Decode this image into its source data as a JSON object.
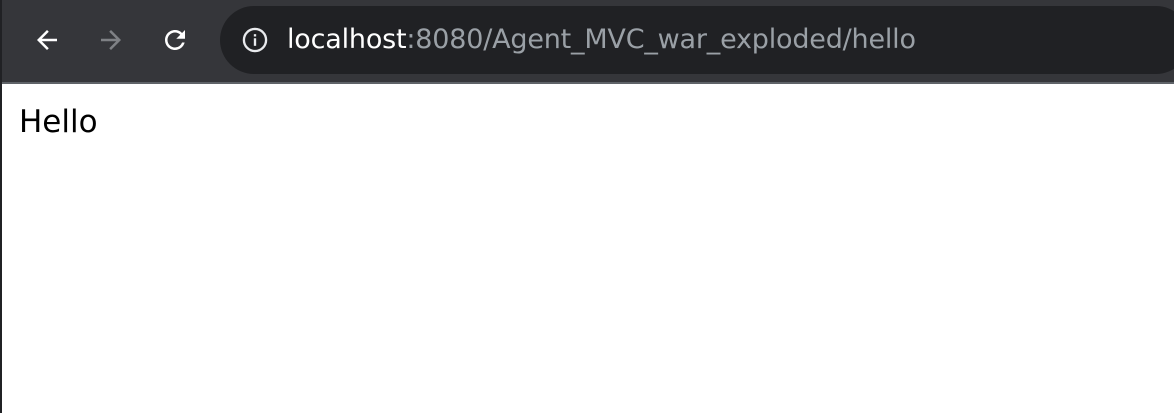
{
  "browser": {
    "url_host": "localhost",
    "url_rest": ":8080/Agent_MVC_war_exploded/hello",
    "icons": {
      "back": "arrow-left-icon",
      "forward": "arrow-right-icon",
      "reload": "reload-icon",
      "site_info": "info-icon"
    },
    "forward_enabled": false
  },
  "page": {
    "body_text": "Hello"
  },
  "colors": {
    "toolbar_bg": "#35363a",
    "omnibox_bg": "#202124",
    "url_host": "#ffffff",
    "url_rest": "#9aa0a6",
    "icon_active": "#ffffff",
    "icon_disabled": "#7f8185"
  }
}
